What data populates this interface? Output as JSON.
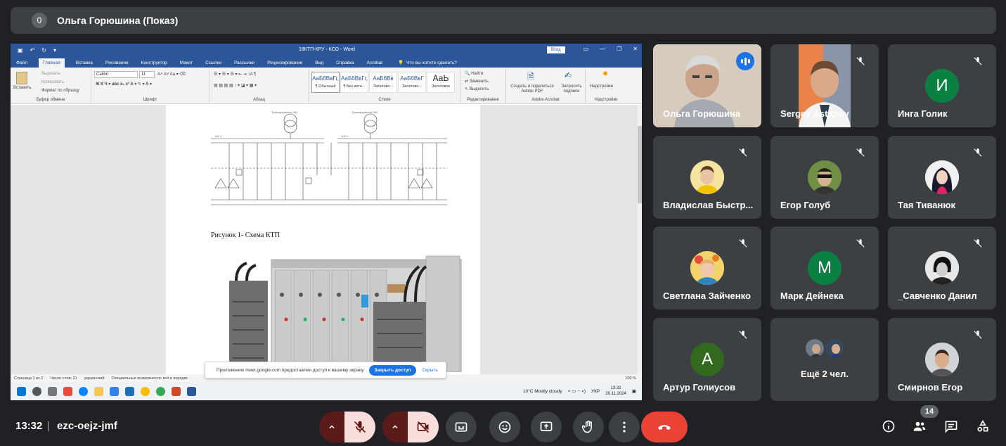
{
  "presenter_bar": {
    "count": "0",
    "title": "Ольга Горюшина (Показ)"
  },
  "word": {
    "doc_title": "18КТП-КРУ - КСО  -  Word",
    "login_label": "Вход",
    "tabs": [
      "Файл",
      "Главная",
      "Вставка",
      "Рисование",
      "Конструктор",
      "Макет",
      "Ссылки",
      "Рассылки",
      "Рецензирование",
      "Вид",
      "Справка",
      "Acrobat"
    ],
    "tell_me": "Что вы хотите сделать?",
    "clipboard": {
      "paste": "Вставить",
      "cut": "Вырезать",
      "copy": "Копировать",
      "format": "Формат по образцу",
      "group": "Буфер обмена"
    },
    "font": {
      "name": "Calibri",
      "size": "11",
      "group": "Шрифт"
    },
    "paragraph_group": "Абзац",
    "styles": {
      "group": "Стили",
      "items": [
        {
          "sample": "АаБбВвГг,",
          "label": "¶ Обычный"
        },
        {
          "sample": "АаБбВвГг,",
          "label": "¶ Без инте..."
        },
        {
          "sample": "АаБбВв",
          "label": "Заголово..."
        },
        {
          "sample": "АаБбВвГ",
          "label": "Заголово..."
        },
        {
          "sample": "АаЬ",
          "label": "Заголовок"
        }
      ]
    },
    "editing": {
      "find": "Найти",
      "replace": "Заменить",
      "select": "Выделить",
      "group": "Редактирование"
    },
    "acrobat": {
      "create": "Создать и поделиться Adobe PDF",
      "request": "Запросить подписи",
      "group": "Adobe Acrobat"
    },
    "addins": {
      "label": "Надстройки",
      "group": "Надстройки"
    },
    "caption": "Рисунок 1- Схема КТП",
    "status": {
      "page": "Страница 1 из 2",
      "words": "Число слов: 21",
      "lang": "украинский",
      "access": "Специальные возможности: всё в порядке",
      "zoom": "100 %"
    },
    "share_notice": {
      "text": "Приложению meet.google.com предоставлен доступ к вашему экрану.",
      "stop": "Закрыть доступ",
      "hide": "Скрыть"
    },
    "taskbar": {
      "weather": "10°C  Mostly cloudy",
      "lang": "УКР",
      "time": "13:32",
      "date": "20.11.2024"
    }
  },
  "participants": [
    {
      "name": "Ольга Горюшина",
      "speaking": true,
      "kind": "video"
    },
    {
      "name": "Sergey Astapov",
      "kind": "video",
      "muted": true
    },
    {
      "name": "Инга Голик",
      "initial": "И",
      "color": "#0b8043",
      "muted": true
    },
    {
      "name": "Владислав Быстр...",
      "kind": "photo",
      "muted": true
    },
    {
      "name": "Егор Голуб",
      "kind": "photo",
      "muted": true
    },
    {
      "name": "Тая Тиванюк",
      "kind": "photo",
      "muted": true
    },
    {
      "name": "Светлана Зайченко",
      "kind": "photo",
      "muted": true
    },
    {
      "name": "Марк Дейнека",
      "initial": "М",
      "color": "#0b8043",
      "muted": true
    },
    {
      "name": "_Савченко Данил",
      "kind": "photo",
      "muted": true
    },
    {
      "name": "Артур Голиусов",
      "initial": "А",
      "color": "#33691e",
      "muted": true
    },
    {
      "name": "Ещё 2 чел.",
      "kind": "more"
    },
    {
      "name": "Смирнов Егор",
      "kind": "photo",
      "muted": true
    }
  ],
  "bottom": {
    "time": "13:32",
    "separator": "|",
    "meeting_code": "ezc-oejz-jmf",
    "people_count": "14"
  },
  "colors": {
    "bg": "#202124",
    "tile": "#3c4043",
    "accent": "#8ab4f8",
    "danger": "#ea4335"
  }
}
